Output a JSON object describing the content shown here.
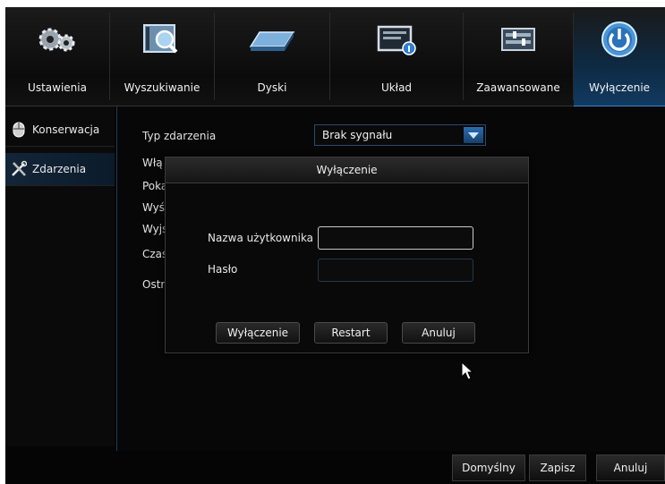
{
  "topnav": {
    "tabs": [
      {
        "label": "Ustawienia",
        "icon": "gears-icon"
      },
      {
        "label": "Wyszukiwanie",
        "icon": "search-film-icon"
      },
      {
        "label": "Dyski",
        "icon": "hard-disk-icon"
      },
      {
        "label": "Układ",
        "icon": "monitor-info-icon"
      },
      {
        "label": "Zaawansowane",
        "icon": "advanced-panel-icon"
      },
      {
        "label": "Wyłączenie",
        "icon": "power-icon",
        "active": true
      }
    ]
  },
  "sidebar": {
    "items": [
      {
        "label": "Konserwacja",
        "icon": "mouse-icon"
      },
      {
        "label": "Zdarzenia",
        "icon": "tools-icon",
        "active": true
      }
    ]
  },
  "main": {
    "event_type_label": "Typ zdarzenia",
    "event_type_value": "Brak sygnału",
    "partial_rows": [
      "Włą",
      "Poka",
      "Wyś",
      "Wyjś",
      "Czas",
      "Ostr"
    ]
  },
  "dialog": {
    "title": "Wyłączenie",
    "username_label": "Nazwa użytkownika",
    "username_value": "",
    "password_label": "Hasło",
    "password_value": "",
    "buttons": {
      "shutdown": "Wyłączenie",
      "restart": "Restart",
      "cancel": "Anuluj"
    }
  },
  "bottombar": {
    "default": "Domyślny",
    "save": "Zapisz",
    "cancel": "Anuluj"
  },
  "colors": {
    "accent": "#3a86cc",
    "background": "#050505"
  }
}
